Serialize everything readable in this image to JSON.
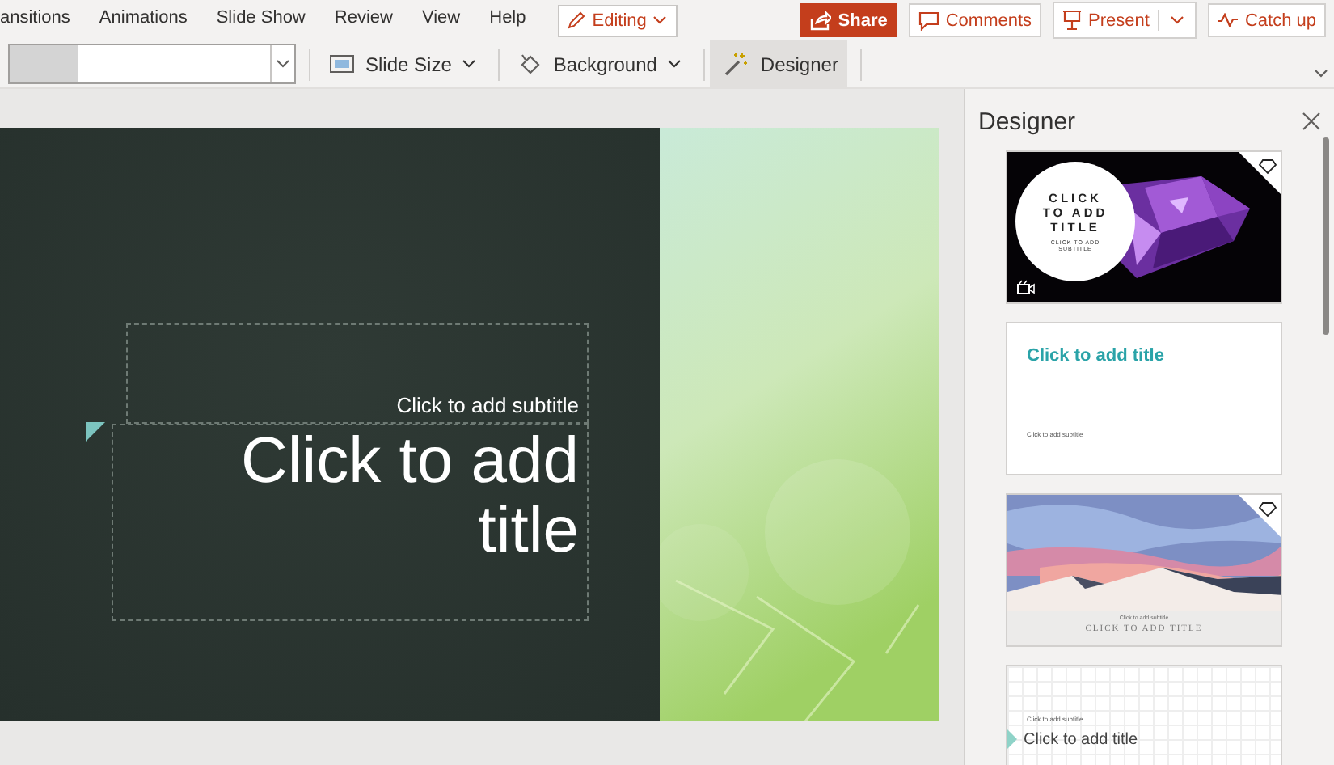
{
  "ribbon_tabs": [
    {
      "label": "ansitions"
    },
    {
      "label": "Animations"
    },
    {
      "label": "Slide Show"
    },
    {
      "label": "Review"
    },
    {
      "label": "View"
    },
    {
      "label": "Help"
    }
  ],
  "mode_button": {
    "label": "Editing"
  },
  "actions": [
    {
      "label": "Share",
      "kind": "share"
    },
    {
      "label": "Comments",
      "kind": "comments"
    },
    {
      "label": "Present",
      "kind": "present"
    },
    {
      "label": "Catch up",
      "kind": "catchup"
    }
  ],
  "toolbar": [
    {
      "label": "Slide Size",
      "kind": "slide-size",
      "selected": false
    },
    {
      "label": "Background",
      "kind": "background",
      "selected": false
    },
    {
      "label": "Designer",
      "kind": "designer",
      "selected": true
    }
  ],
  "slide": {
    "subtitle_placeholder": "Click to add subtitle",
    "title_placeholder": "Click to add title"
  },
  "designer": {
    "title": "Designer",
    "thumbnails": [
      {
        "kind": "gem",
        "title": "CLICK TO ADD TITLE",
        "subtitle": "CLICK TO ADD SUBTITLE",
        "premium": true,
        "video": true
      },
      {
        "kind": "plain",
        "title": "Click to add title",
        "subtitle": "Click to add subtitle",
        "premium": false
      },
      {
        "kind": "mountain",
        "title": "CLICK TO ADD TITLE",
        "subtitle": "Click to add subtitle",
        "premium": true
      },
      {
        "kind": "grid",
        "title": "Click to add title",
        "subtitle": "Click to add subtitle",
        "premium": false
      }
    ]
  }
}
